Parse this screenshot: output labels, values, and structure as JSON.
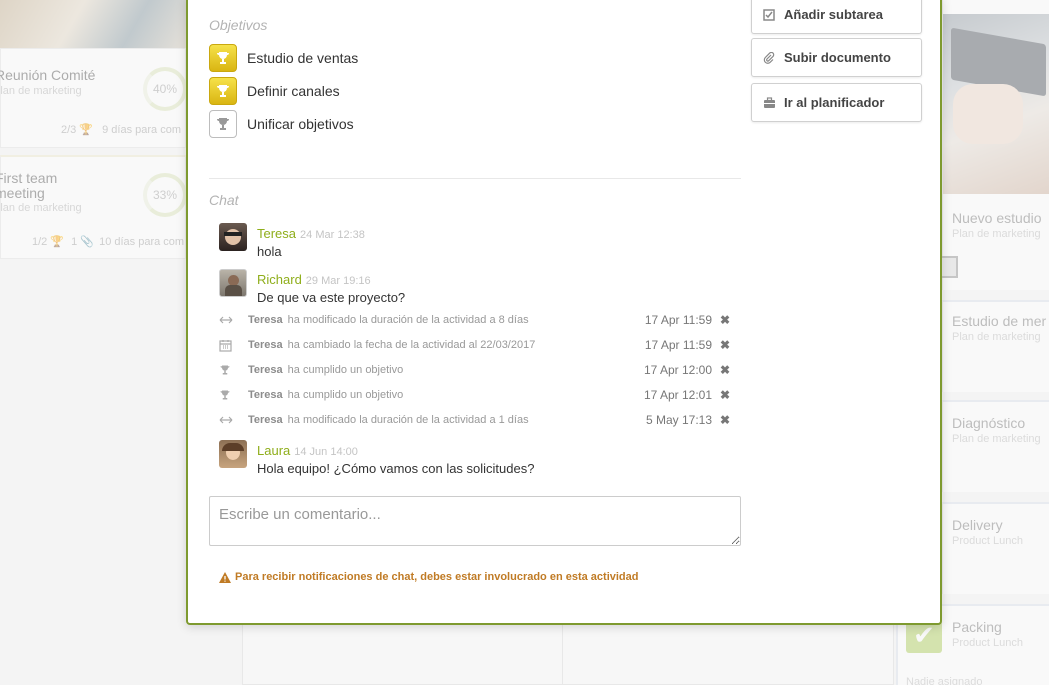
{
  "left_cards": [
    {
      "title": "Reunión Comité",
      "subtitle": "Plan de marketing",
      "progress": "40%",
      "objectives": "2/3",
      "days": "9 días para com"
    },
    {
      "title": "First team meeting",
      "subtitle": "Plan de marketing",
      "progress": "33%",
      "objectives": "1/2",
      "attachments": "1",
      "days": "10 días para com"
    }
  ],
  "right_cards": [
    {
      "title": "Nuevo estudio",
      "subtitle": "Plan de marketing"
    },
    {
      "title": "Estudio de mer",
      "subtitle": "Plan de marketing"
    },
    {
      "title": "Diagnóstico",
      "subtitle": "Plan de marketing"
    },
    {
      "title": "Delivery",
      "subtitle": "Product Lunch"
    },
    {
      "title": "Packing",
      "subtitle": "Product Lunch",
      "footer": "Nadie asignado"
    }
  ],
  "modal": {
    "objectives_label": "Objetivos",
    "objectives": [
      {
        "label": "Estudio de ventas",
        "done": true
      },
      {
        "label": "Definir canales",
        "done": true
      },
      {
        "label": "Unificar objetivos",
        "done": false
      }
    ],
    "actions": [
      {
        "label": "Añadir subtarea",
        "icon": "checkbox-icon"
      },
      {
        "label": "Subir documento",
        "icon": "paperclip-icon"
      },
      {
        "label": "Ir al planificador",
        "icon": "briefcase-icon"
      }
    ],
    "chat_label": "Chat",
    "messages": [
      {
        "author": "Teresa",
        "time": "24 Mar 12:38",
        "text": "hola"
      },
      {
        "author": "Richard",
        "time": "29 Mar 19:16",
        "text": "De que va este proyecto?"
      },
      {
        "author": "Laura",
        "time": "14 Jun 14:00",
        "text": "Hola equipo! ¿Cómo vamos con las solicitudes?"
      }
    ],
    "logs": [
      {
        "icon": "resize-arrows-icon",
        "user": "Teresa",
        "action": "ha modificado la duración de la actividad a 8 días",
        "time": "17 Apr 11:59"
      },
      {
        "icon": "calendar-icon",
        "user": "Teresa",
        "action": "ha cambiado la fecha de la actividad al 22/03/2017",
        "time": "17 Apr 11:59"
      },
      {
        "icon": "trophy-icon",
        "user": "Teresa",
        "action": "ha cumplido un objetivo",
        "time": "17 Apr 12:00"
      },
      {
        "icon": "trophy-icon",
        "user": "Teresa",
        "action": "ha cumplido un objetivo",
        "time": "17 Apr 12:01"
      },
      {
        "icon": "resize-arrows-icon",
        "user": "Teresa",
        "action": "ha modificado la duración de la actividad a 1 días",
        "time": "5 May 17:13"
      }
    ],
    "delete_glyph": "✖",
    "comment_placeholder": "Escribe un comentario...",
    "warning": "Para recibir notificaciones de chat, debes estar involucrado en esta actividad"
  },
  "colors": {
    "accent": "#8fae1b",
    "modal_border": "#7e9a2f",
    "warning": "#c07b25",
    "trophy_gold": "#e8c72a"
  }
}
